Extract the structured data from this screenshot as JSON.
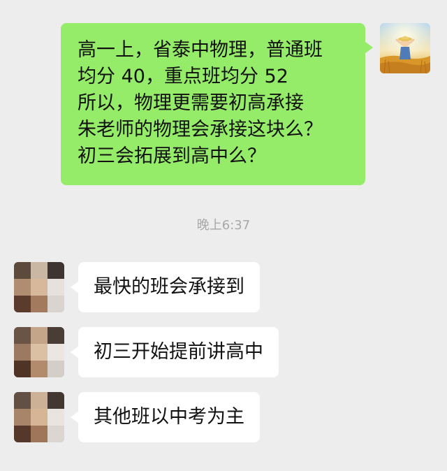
{
  "outgoing": {
    "lines": [
      "高一上，省泰中物理，普通班",
      "均分 40，重点班均分 52",
      "所以，物理更需要初高承接",
      "朱老师的物理会承接这块么？",
      "初三会拓展到高中么？"
    ],
    "bubble_color": "#95ec69"
  },
  "timestamp": "晚上6:37",
  "incoming": [
    {
      "text": "最快的班会承接到"
    },
    {
      "text": "初三开始提前讲高中"
    },
    {
      "text": "其他班以中考为主"
    }
  ],
  "colors": {
    "background": "#ededed",
    "incoming_bubble": "#ffffff",
    "timestamp": "#a8a8a8"
  },
  "icons": {
    "self_avatar": "child-in-wheat-field-avatar",
    "other_avatar": "blurred-person-avatar"
  }
}
